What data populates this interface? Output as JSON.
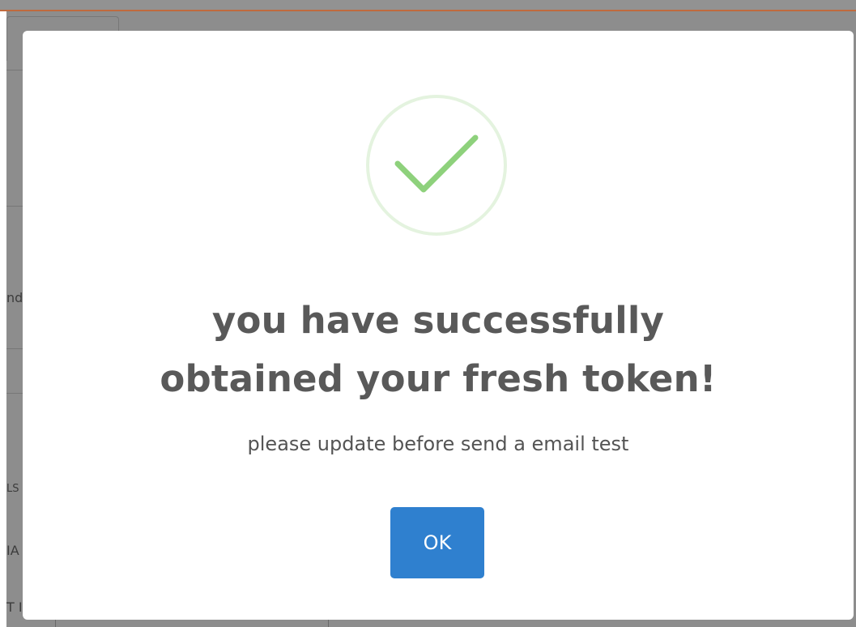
{
  "colors": {
    "accent": "#2f80cf",
    "success": "#8ed17c",
    "success_ring": "#e4f3df",
    "title_text": "#595959",
    "overlay": "#8d8d8d"
  },
  "background": {
    "partial_labels": [
      "nd",
      "LS",
      "IA",
      "T I"
    ]
  },
  "dialog": {
    "icon": "checkmark-success-icon",
    "title_line1": "you have successfully",
    "title_line2": "obtained your fresh token!",
    "message": "please update before send a email test",
    "ok_label": "OK"
  }
}
